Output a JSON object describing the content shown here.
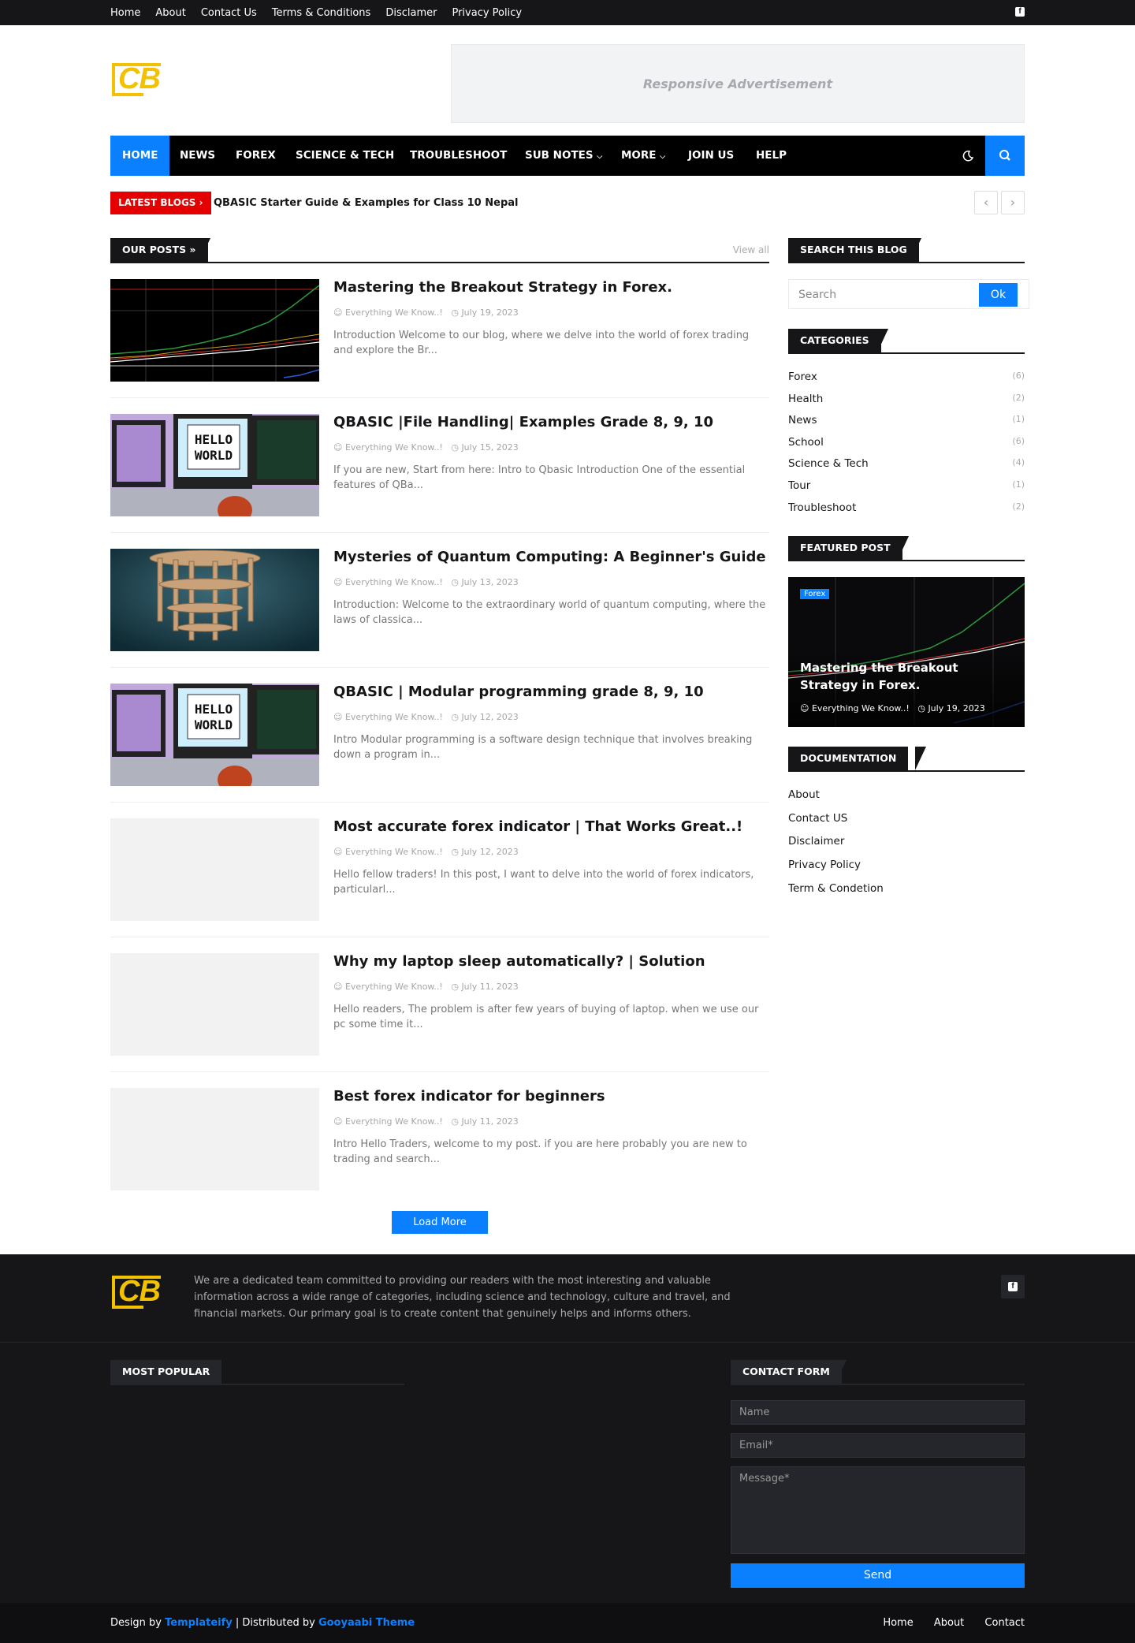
{
  "topmenu": [
    "Home",
    "About",
    "Contact Us",
    "Terms & Conditions",
    "Disclamer",
    "Privacy Policy"
  ],
  "logo_text": "CB",
  "ad_text": "Responsive Advertisement",
  "nav": {
    "items": [
      "HOME",
      "NEWS",
      "FOREX",
      "SCIENCE & TECH",
      "TROUBLESHOOT",
      "SUB NOTES",
      "MORE",
      "JOIN US",
      "HELP"
    ]
  },
  "ticker": {
    "label": "LATEST BLOGS",
    "text": "QBASIC Starter Guide & Examples for Class 10 Nepal"
  },
  "main": {
    "section_title": "OUR POSTS",
    "view_all": "View all",
    "posts": [
      {
        "title": "Mastering the Breakout Strategy in Forex.",
        "author": "Everything We Know..!",
        "date": "July 19, 2023",
        "excerpt": "Introduction Welcome to our blog, where we delve into the world of forex trading and explore the Br..."
      },
      {
        "title": "QBASIC |File Handling| Examples Grade 8, 9, 10",
        "author": "Everything We Know..!",
        "date": "July 15, 2023",
        "excerpt": "If you are new, Start from here:  Intro to Qbasic Introduction One of the essential features of QBa..."
      },
      {
        "title": "Mysteries of Quantum Computing: A Beginner's Guide",
        "author": "Everything We Know..!",
        "date": "July 13, 2023",
        "excerpt": "Introduction: Welcome to the extraordinary world of quantum computing, where the laws of classica..."
      },
      {
        "title": "QBASIC | Modular programming grade 8, 9, 10",
        "author": "Everything We Know..!",
        "date": "July 12, 2023",
        "excerpt": "Intro Modular programming is a software design technique that involves breaking down a program in..."
      },
      {
        "title": "Most accurate forex indicator | That Works Great..!",
        "author": "Everything We Know..!",
        "date": "July 12, 2023",
        "excerpt": "Hello fellow traders! In this post, I want to delve into the world of forex indicators, particularl..."
      },
      {
        "title": "Why my laptop sleep automatically? | Solution",
        "author": "Everything We Know..!",
        "date": "July 11, 2023",
        "excerpt": "Hello readers, The problem is after few years of buying of laptop. when we use our pc some time it..."
      },
      {
        "title": "Best forex indicator for beginners",
        "author": "Everything We Know..!",
        "date": "July 11, 2023",
        "excerpt": "Intro Hello Traders, welcome to my post. if you are here probably you are new to trading and search..."
      }
    ],
    "load_more": "Load More",
    "thumb_hello_line1": "HELLO",
    "thumb_hello_line2": "WORLD"
  },
  "sidebar": {
    "search_title": "SEARCH THIS BLOG",
    "search_placeholder": "Search",
    "search_button": "Ok",
    "categories_title": "CATEGORIES",
    "categories": [
      {
        "name": "Forex",
        "count": "(6)"
      },
      {
        "name": "Health",
        "count": "(2)"
      },
      {
        "name": "News",
        "count": "(1)"
      },
      {
        "name": "School",
        "count": "(6)"
      },
      {
        "name": "Science & Tech",
        "count": "(4)"
      },
      {
        "name": "Tour",
        "count": "(1)"
      },
      {
        "name": "Troubleshoot",
        "count": "(2)"
      }
    ],
    "featured_title": "FEATURED POST",
    "featured": {
      "tag": "Forex",
      "title": "Mastering the Breakout Strategy in Forex.",
      "author": "Everything We Know..!",
      "date": "July 19, 2023"
    },
    "documentation_title": "DOCUMENTATION",
    "documentation": [
      "About",
      "Contact US",
      "Disclaimer",
      "Privacy Policy",
      "Term & Condetion"
    ]
  },
  "footer": {
    "about_text": "We are a dedicated team committed to providing our readers with the most interesting and valuable information across a wide range of categories, including science and technology, culture and travel, and financial markets. Our primary goal is to create content that genuinely helps and informs others.",
    "most_popular_title": "MOST POPULAR",
    "contact_title": "CONTACT FORM",
    "name_placeholder": "Name",
    "email_placeholder": "Email*",
    "message_placeholder": "Message*",
    "send_label": "Send",
    "design_by_prefix": "Design by",
    "design_by": "Templateify",
    "distributed_prefix": "| Distributed by",
    "distributed_by": "Gooyaabi Theme",
    "links": [
      "Home",
      "About",
      "Contact"
    ]
  },
  "colors": {
    "accent": "#0b80ff",
    "dark": "#161619",
    "ticker": "#e40000",
    "logo": "#f2c200"
  }
}
